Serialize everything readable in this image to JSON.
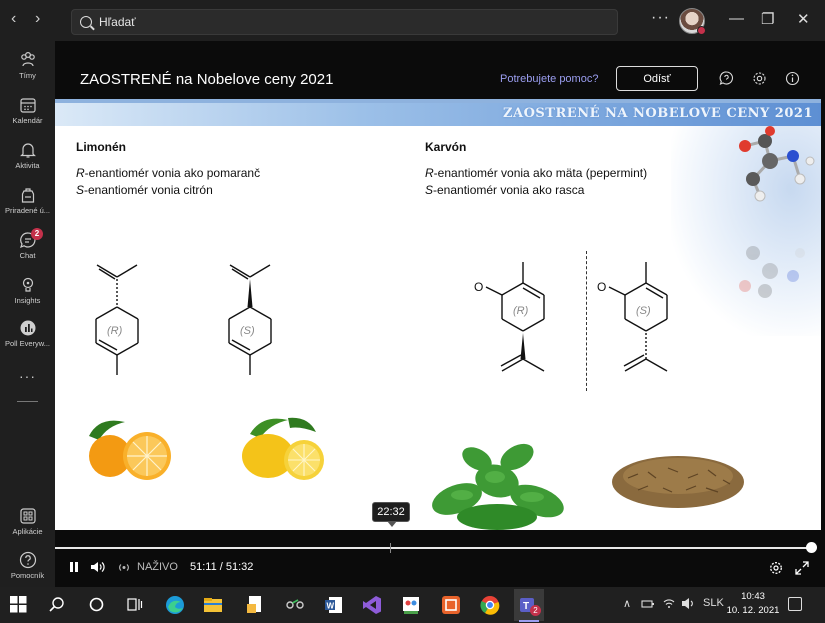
{
  "titlebar": {
    "search_placeholder": "Hľadať",
    "more_label": "···",
    "back_icon": "chevron-left-icon",
    "forward_icon": "chevron-right-icon",
    "minimize": "—",
    "restore": "❐",
    "close": "✕"
  },
  "rail": {
    "items": [
      {
        "label": "Tímy",
        "icon": "teams-icon"
      },
      {
        "label": "Kalendár",
        "icon": "calendar-icon"
      },
      {
        "label": "Aktivita",
        "icon": "bell-icon"
      },
      {
        "label": "Priradené ú...",
        "icon": "assignments-icon"
      },
      {
        "label": "Chat",
        "icon": "chat-icon",
        "badge": "2"
      },
      {
        "label": "Insights",
        "icon": "insights-icon"
      },
      {
        "label": "Poll Everyw...",
        "icon": "poll-icon"
      }
    ],
    "more_dots": "···",
    "apps_label": "Aplikácie",
    "help_label": "Pomocník"
  },
  "meeting": {
    "title": "ZAOSTRENÉ na Nobelove ceny 2021",
    "help_link": "Potrebujete pomoc?",
    "leave_label": "Odísť"
  },
  "slide": {
    "banner": "ZAOSTRENÉ NA NOBELOVE CENY 2021",
    "left": {
      "title": "Limonén",
      "line1_prefix": "R",
      "line1_text": "-enantiomér vonia ako pomaranč",
      "line2_prefix": "S",
      "line2_text": "-enantiomér vonia citrón",
      "label_r": "(R)",
      "label_s": "(S)"
    },
    "right": {
      "title": "Karvón",
      "line1_prefix": "R",
      "line1_text": "-enantiomér vonia ako mäta (pepermint)",
      "line2_prefix": "S",
      "line2_text": "-enantiomér vonia ako rasca",
      "label_r": "(R)",
      "label_s": "(S)",
      "atom_o": "O"
    }
  },
  "player": {
    "tooltip_time": "22:32",
    "live_label": "NAŽIVO",
    "position": "51:11  /  51:32",
    "progress_fraction": 0.991
  },
  "taskbar": {
    "language": "SLK",
    "time": "10:43",
    "date": "10. 12. 2021",
    "teams_badge": "2"
  },
  "colors": {
    "accent_link": "#9b9ef0",
    "badge": "#c4314b",
    "banner_blue": "#5d8fd3"
  }
}
